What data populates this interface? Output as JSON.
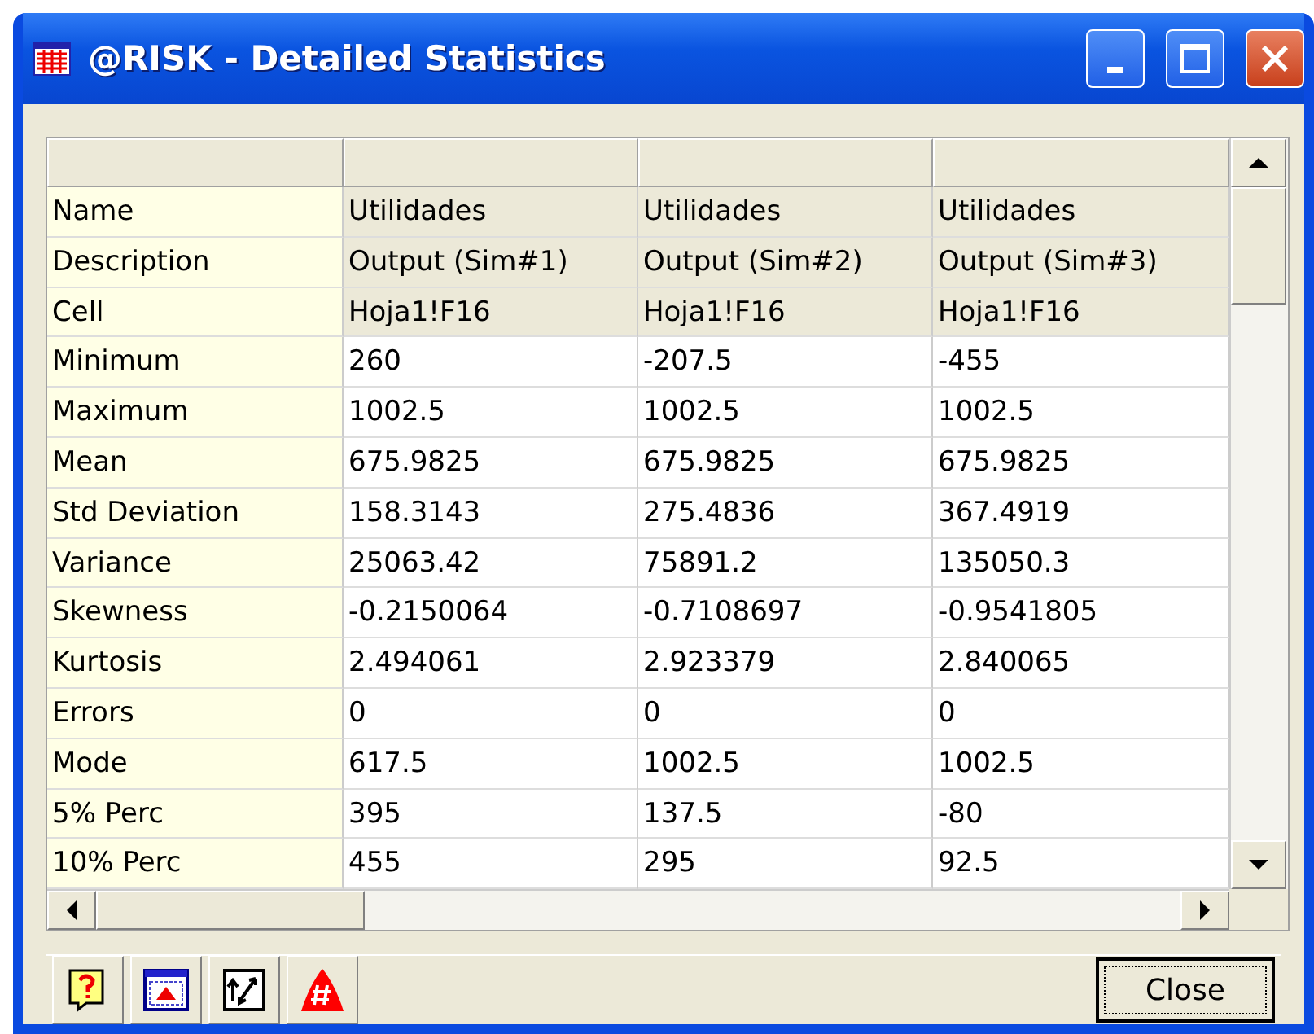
{
  "window": {
    "title": "@RISK - Detailed Statistics"
  },
  "table": {
    "rows": [
      {
        "kind": "info",
        "label": "Name",
        "cells": [
          "Utilidades",
          "Utilidades",
          "Utilidades"
        ]
      },
      {
        "kind": "info",
        "label": "Description",
        "cells": [
          "Output (Sim#1)",
          "Output (Sim#2)",
          "Output (Sim#3)"
        ]
      },
      {
        "kind": "info",
        "label": "Cell",
        "cells": [
          "Hoja1!F16",
          "Hoja1!F16",
          "Hoja1!F16"
        ]
      },
      {
        "kind": "stat",
        "label": "Minimum",
        "cells": [
          "260",
          "-207.5",
          "-455"
        ]
      },
      {
        "kind": "stat",
        "label": "Maximum",
        "cells": [
          "1002.5",
          "1002.5",
          "1002.5"
        ]
      },
      {
        "kind": "stat",
        "label": "Mean",
        "cells": [
          "675.9825",
          "675.9825",
          "675.9825"
        ]
      },
      {
        "kind": "stat",
        "label": "Std Deviation",
        "cells": [
          "158.3143",
          "275.4836",
          "367.4919"
        ]
      },
      {
        "kind": "stat",
        "label": "Variance",
        "cells": [
          "25063.42",
          "75891.2",
          "135050.3"
        ]
      },
      {
        "kind": "stat",
        "label": "Skewness",
        "cells": [
          "-0.2150064",
          "-0.7108697",
          "-0.9541805"
        ]
      },
      {
        "kind": "stat",
        "label": "Kurtosis",
        "cells": [
          "2.494061",
          "2.923379",
          "2.840065"
        ]
      },
      {
        "kind": "stat",
        "label": "Errors",
        "cells": [
          "0",
          "0",
          "0"
        ]
      },
      {
        "kind": "stat",
        "label": "Mode",
        "cells": [
          "617.5",
          "1002.5",
          "1002.5"
        ]
      },
      {
        "kind": "stat",
        "label": "5% Perc",
        "cells": [
          "395",
          "137.5",
          "-80"
        ]
      },
      {
        "kind": "stat",
        "label": "10% Perc",
        "cells": [
          "455",
          "295",
          "92.5"
        ]
      }
    ]
  },
  "toolbar": [
    {
      "kind": "help"
    },
    {
      "kind": "chart"
    },
    {
      "kind": "swap"
    },
    {
      "kind": "alert"
    }
  ],
  "close_button": "Close"
}
